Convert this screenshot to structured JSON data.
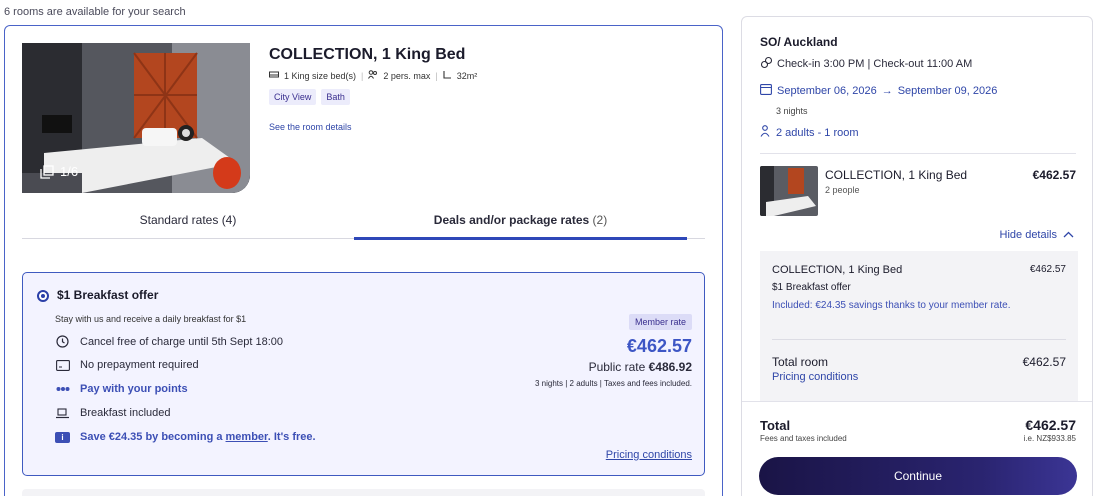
{
  "availability_note": "6 rooms are available for your search",
  "room": {
    "title": "COLLECTION, 1 King Bed",
    "bed": "1 King size bed(s)",
    "max_persons": "2 pers. max",
    "area": "32m²",
    "tags": [
      "City View",
      "Bath"
    ],
    "details_link": "See the room details",
    "photo_counter": "1/6"
  },
  "tabs": {
    "standard_label": "Standard rates",
    "standard_count": "(4)",
    "deals_label": "Deals and/or package rates",
    "deals_count": "(2)"
  },
  "offer": {
    "title": "$1 Breakfast offer",
    "description": "Stay with us and receive a daily breakfast for $1",
    "cancel": "Cancel free of charge until 5th Sept 18:00",
    "prepayment": "No prepayment required",
    "points": "Pay with your points",
    "breakfast": "Breakfast included",
    "save_prefix": "Save €24.35 by becoming a ",
    "save_link": "member",
    "save_suffix": ". It's free.",
    "member_badge": "Member rate",
    "price": "€462.57",
    "public_rate_label": "Public rate ",
    "public_rate_value": "€486.92",
    "price_note": "3 nights | 2 adults | Taxes and fees included.",
    "pricing_link": "Pricing conditions"
  },
  "summary": {
    "hotel": "SO/ Auckland",
    "checkin": "Check-in 3:00 PM | Check-out 11:00 AM",
    "date_from": "September 06, 2026",
    "date_to": "September 09, 2026",
    "nights": "3 nights",
    "guests": "2 adults - 1 room",
    "room_name": "COLLECTION, 1 King Bed",
    "room_people": "2 people",
    "room_price": "€462.57",
    "hide_details": "Hide details",
    "details": {
      "room": "COLLECTION, 1 King Bed",
      "room_price": "€462.57",
      "offer": "$1 Breakfast offer",
      "included": "Included: €24.35 savings thanks to your member rate.",
      "total_room_label": "Total room",
      "total_room_price": "€462.57",
      "pricing_link": "Pricing conditions"
    },
    "total_label": "Total",
    "total_sub": "Fees and taxes included",
    "total_price": "€462.57",
    "total_nzd": "i.e. NZ$933.85",
    "continue": "Continue"
  },
  "colors": {
    "accent": "#2e47b8",
    "price": "#3d56c5",
    "offer_bg": "#f3f3ff",
    "button": "#1a1446"
  }
}
